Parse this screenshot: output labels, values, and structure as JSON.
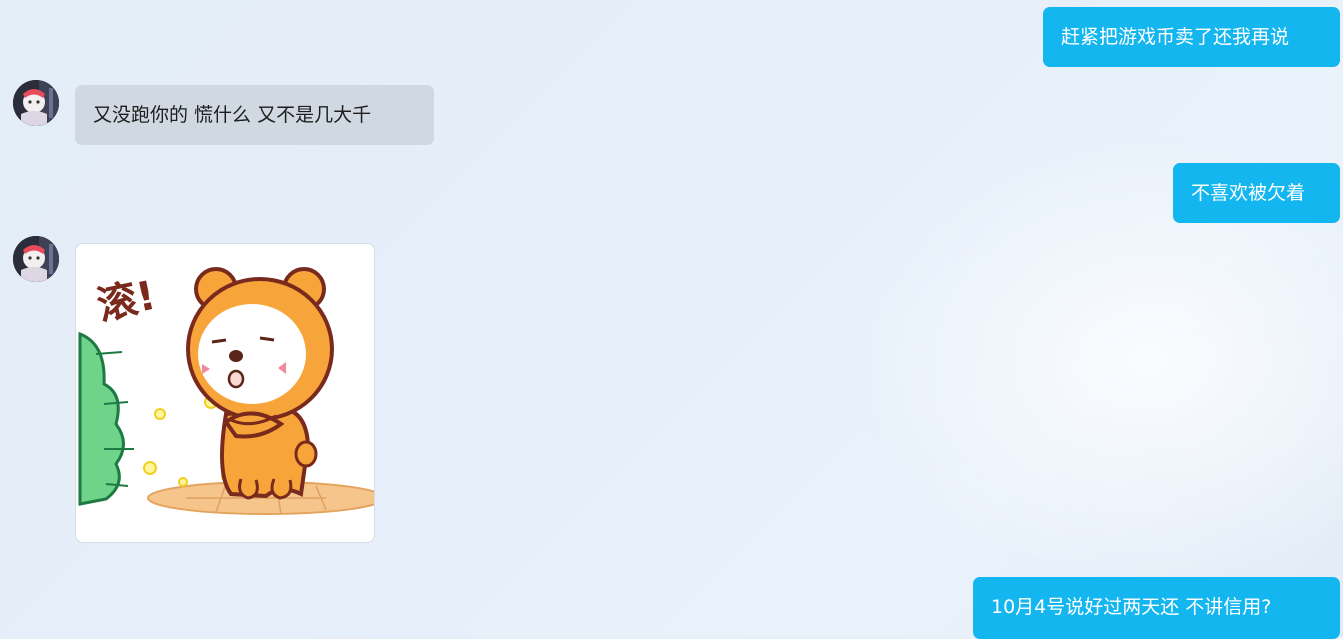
{
  "messages": [
    {
      "side": "outgoing",
      "type": "text",
      "text": "赶紧把游戏币卖了还我再说"
    },
    {
      "side": "incoming",
      "type": "text",
      "text": "又没跑你的 慌什么 又不是几大千"
    },
    {
      "side": "outgoing",
      "type": "text",
      "text": "不喜欢被欠着"
    },
    {
      "side": "incoming",
      "type": "sticker",
      "sticker_text": "滚!",
      "sticker_subject": "orange-bear-crossed-arms"
    },
    {
      "side": "outgoing",
      "type": "text",
      "text": "10月4号说好过两天还 不讲信用?"
    }
  ],
  "colors": {
    "outgoing_bubble": "#14b6ef",
    "incoming_bubble": "#d0d9e2",
    "background": "#e6eff9"
  }
}
